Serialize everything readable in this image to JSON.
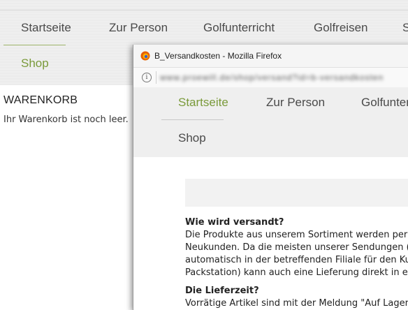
{
  "main_nav": {
    "items": [
      "Startseite",
      "Zur Person",
      "Golfunterricht",
      "Golfreisen",
      "S"
    ],
    "shop": "Shop"
  },
  "cart": {
    "title": "WARENKORB",
    "empty_message": "Ihr Warenkorb ist noch leer."
  },
  "popup": {
    "window_title": "B_Versandkosten - Mozilla Firefox",
    "url": "www.proewill.de/shop/versand?id=b-versandkosten",
    "nav": {
      "items": [
        "Startseite",
        "Zur Person",
        "Golfunter"
      ],
      "shop": "Shop"
    },
    "sections": [
      {
        "heading": "Wie wird versandt?",
        "lines": [
          "Die Produkte aus unserem Sortiment werden per D",
          "Neukunden. Da die meisten unserer Sendungen (G",
          "automatisch in der betreffenden Filiale für den Kun",
          "Packstation) kann auch eine Lieferung direkt in ein"
        ]
      },
      {
        "heading": "Die Lieferzeit?",
        "lines": [
          "Vorrätige Artikel sind mit der Meldung \"Auf Lager\" S"
        ]
      }
    ]
  },
  "colors": {
    "accent_green": "#7a9a3a",
    "nav_bg": "#efefef"
  }
}
